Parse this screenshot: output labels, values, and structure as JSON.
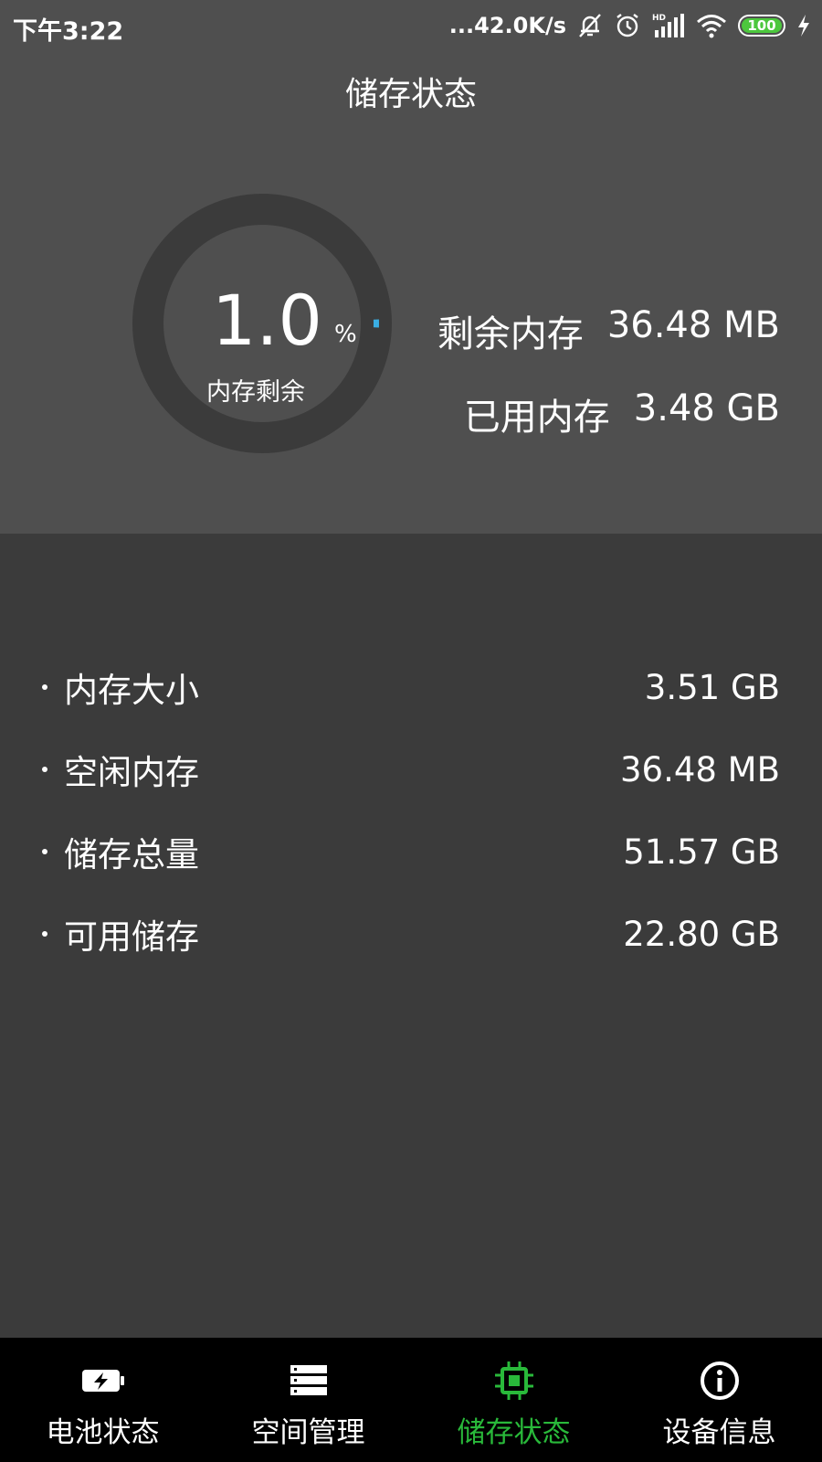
{
  "status_bar": {
    "time": "下午3:22",
    "net_speed": "...42.0K/s",
    "icons": [
      "bell-off-icon",
      "alarm-icon",
      "hd-signal-icon",
      "wifi-icon",
      "battery-icon",
      "charging-icon"
    ],
    "battery_level": "100",
    "battery_color": "#4cc73d"
  },
  "header": {
    "title": "储存状态"
  },
  "gauge": {
    "value": "1.0",
    "unit": "%",
    "caption": "内存剩余",
    "fraction": 0.01,
    "track_color": "#3b3b3b",
    "accent_color": "#3aaee3"
  },
  "memory_summary": {
    "free_label": "剩余内存",
    "free_value": "36.48 MB",
    "used_label": "已用内存",
    "used_value": "3.48 GB"
  },
  "details": [
    {
      "label": "内存大小",
      "value": "3.51 GB"
    },
    {
      "label": "空闲内存",
      "value": "36.48 MB"
    },
    {
      "label": "储存总量",
      "value": "51.57 GB"
    },
    {
      "label": "可用储存",
      "value": "22.80 GB"
    }
  ],
  "bottom_nav": {
    "active_color": "#29b93a",
    "items": [
      {
        "label": "电池状态",
        "icon": "battery-charging-icon",
        "active": false
      },
      {
        "label": "空间管理",
        "icon": "storage-list-icon",
        "active": false
      },
      {
        "label": "储存状态",
        "icon": "chip-icon",
        "active": true
      },
      {
        "label": "设备信息",
        "icon": "info-icon",
        "active": false
      }
    ]
  }
}
